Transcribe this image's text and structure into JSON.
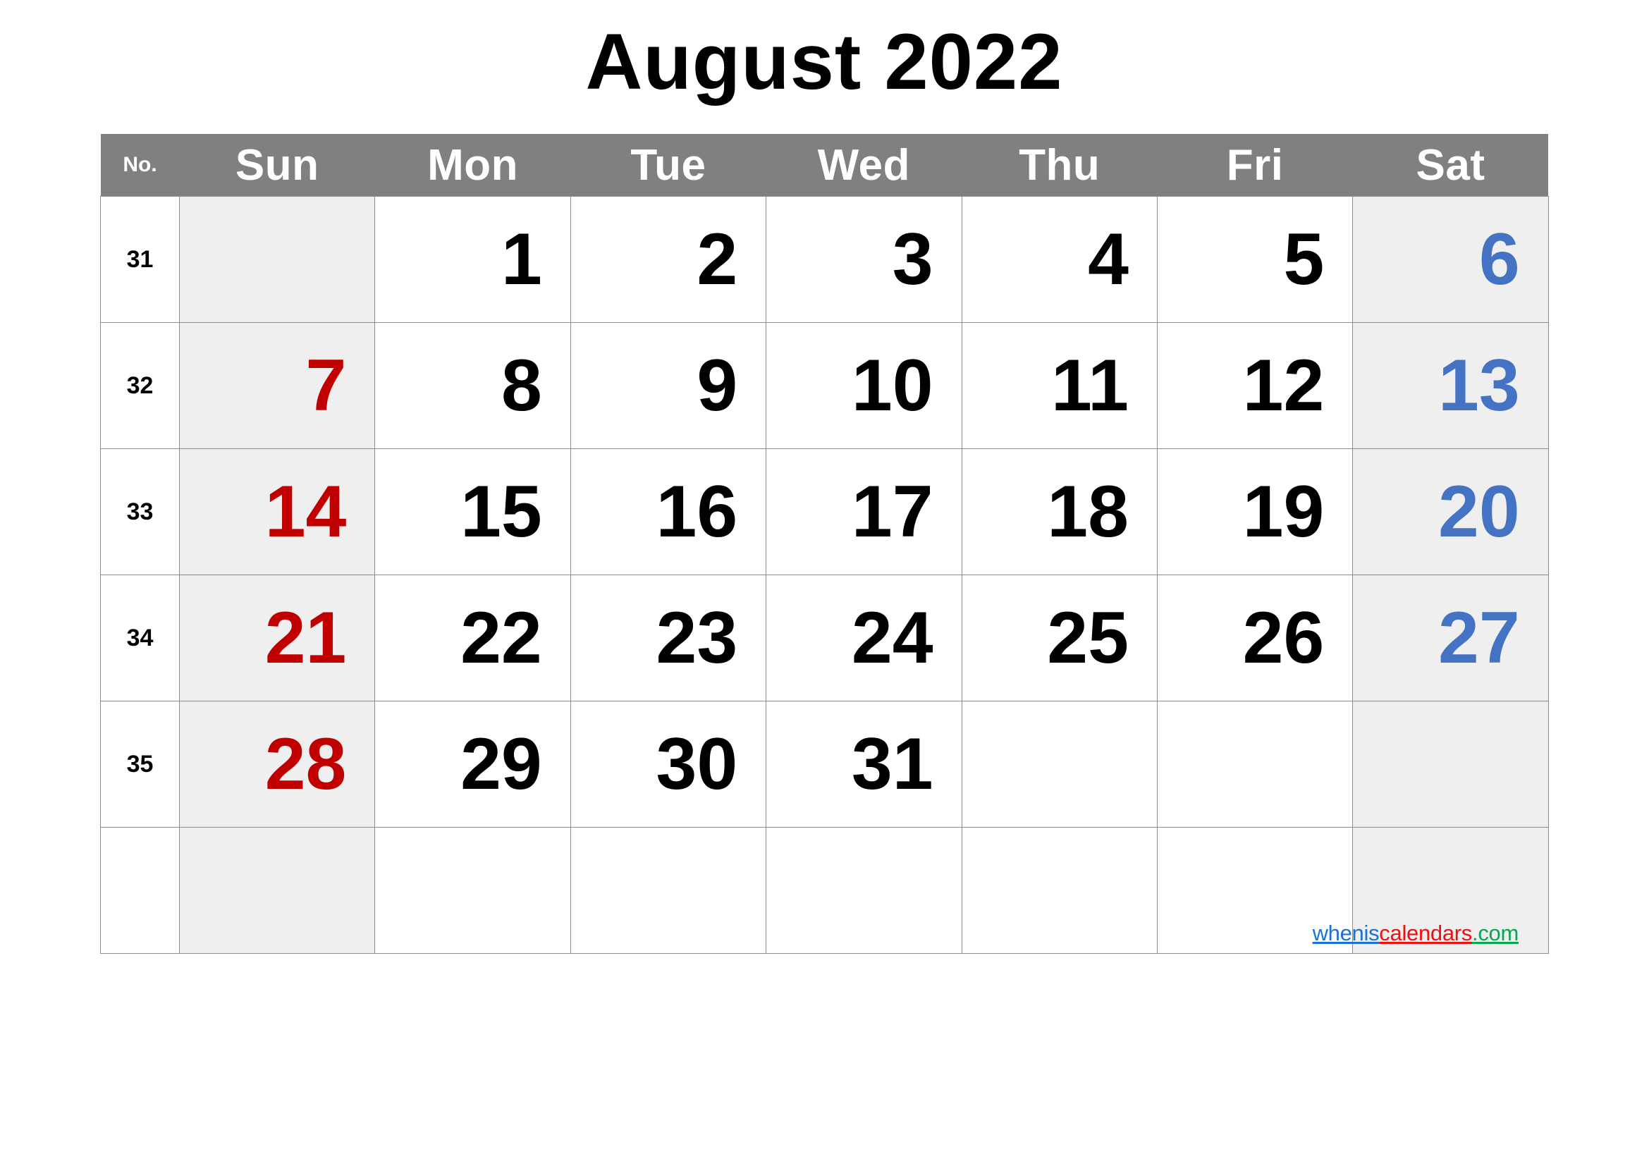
{
  "title": "August 2022",
  "header": {
    "week_number_label": "No.",
    "day_names": [
      "Sun",
      "Mon",
      "Tue",
      "Wed",
      "Thu",
      "Fri",
      "Sat"
    ]
  },
  "colors": {
    "header_background": "#808080",
    "header_text": "#ffffff",
    "weekend_cell_background": "#efefef",
    "sunday_text": "#c00000",
    "saturday_text": "#4573c4",
    "weekday_text": "#000000",
    "grid_line": "#8c8c8c",
    "page_background": "#ffffff"
  },
  "weeks": [
    {
      "week_number": "31",
      "days": [
        "",
        "1",
        "2",
        "3",
        "4",
        "5",
        "6"
      ]
    },
    {
      "week_number": "32",
      "days": [
        "7",
        "8",
        "9",
        "10",
        "11",
        "12",
        "13"
      ]
    },
    {
      "week_number": "33",
      "days": [
        "14",
        "15",
        "16",
        "17",
        "18",
        "19",
        "20"
      ]
    },
    {
      "week_number": "34",
      "days": [
        "21",
        "22",
        "23",
        "24",
        "25",
        "26",
        "27"
      ]
    },
    {
      "week_number": "35",
      "days": [
        "28",
        "29",
        "30",
        "31",
        "",
        "",
        ""
      ]
    },
    {
      "week_number": "",
      "days": [
        "",
        "",
        "",
        "",
        "",
        "",
        ""
      ]
    }
  ],
  "watermark": {
    "part1": "whenis",
    "part2": "calendars",
    "part3": ".com"
  }
}
